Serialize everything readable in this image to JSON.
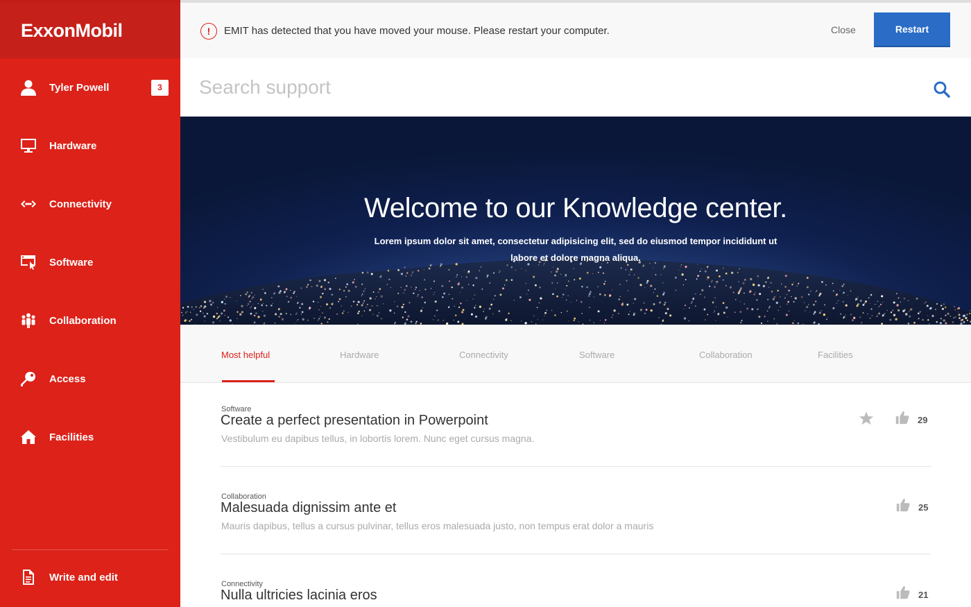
{
  "brand": {
    "logo_text": "ExxonMobil",
    "primary_color": "#dc2219",
    "accent_color": "#2a6cc6"
  },
  "sidebar": {
    "user": {
      "name": "Tyler Powell",
      "badge": "3",
      "icon": "user-icon"
    },
    "items": [
      {
        "label": "Hardware",
        "icon": "monitor-icon"
      },
      {
        "label": "Connectivity",
        "icon": "connectivity-icon"
      },
      {
        "label": "Software",
        "icon": "software-window-icon"
      },
      {
        "label": "Collaboration",
        "icon": "people-icon"
      },
      {
        "label": "Access",
        "icon": "key-icon"
      },
      {
        "label": "Facilities",
        "icon": "home-icon"
      }
    ],
    "footer_item": {
      "label": "Write and edit",
      "icon": "document-icon"
    }
  },
  "alert": {
    "icon": "alert-icon",
    "symbol": "!",
    "message": "EMIT has detected that you have moved your mouse. Please restart your computer.",
    "close_label": "Close",
    "restart_label": "Restart"
  },
  "search": {
    "placeholder": "Search support",
    "icon": "search-icon"
  },
  "hero": {
    "title": "Welcome to our Knowledge center.",
    "subtitle": "Lorem ipsum dolor sit amet, consectetur adipisicing elit, sed do eiusmod tempor incididunt ut labore et dolore magna aliqua."
  },
  "tabs": [
    {
      "label": "Most helpful",
      "active": true
    },
    {
      "label": "Hardware",
      "active": false
    },
    {
      "label": "Connectivity",
      "active": false
    },
    {
      "label": "Software",
      "active": false
    },
    {
      "label": "Collaboration",
      "active": false
    },
    {
      "label": "Facilities",
      "active": false
    }
  ],
  "articles": [
    {
      "category": "Software",
      "title": "Create a perfect presentation in Powerpoint",
      "description": "Vestibulum eu dapibus tellus, in lobortis lorem. Nunc eget cursus magna.",
      "likes": "29",
      "starred": true
    },
    {
      "category": "Collaboration",
      "title": "Malesuada dignissim ante et",
      "description": "Mauris dapibus, tellus a cursus pulvinar, tellus eros malesuada justo, non tempus erat dolor a mauris",
      "likes": "25",
      "starred": false
    },
    {
      "category": "Connectivity",
      "title": "Nulla ultricies lacinia eros",
      "description": "",
      "likes": "21",
      "starred": false
    }
  ]
}
